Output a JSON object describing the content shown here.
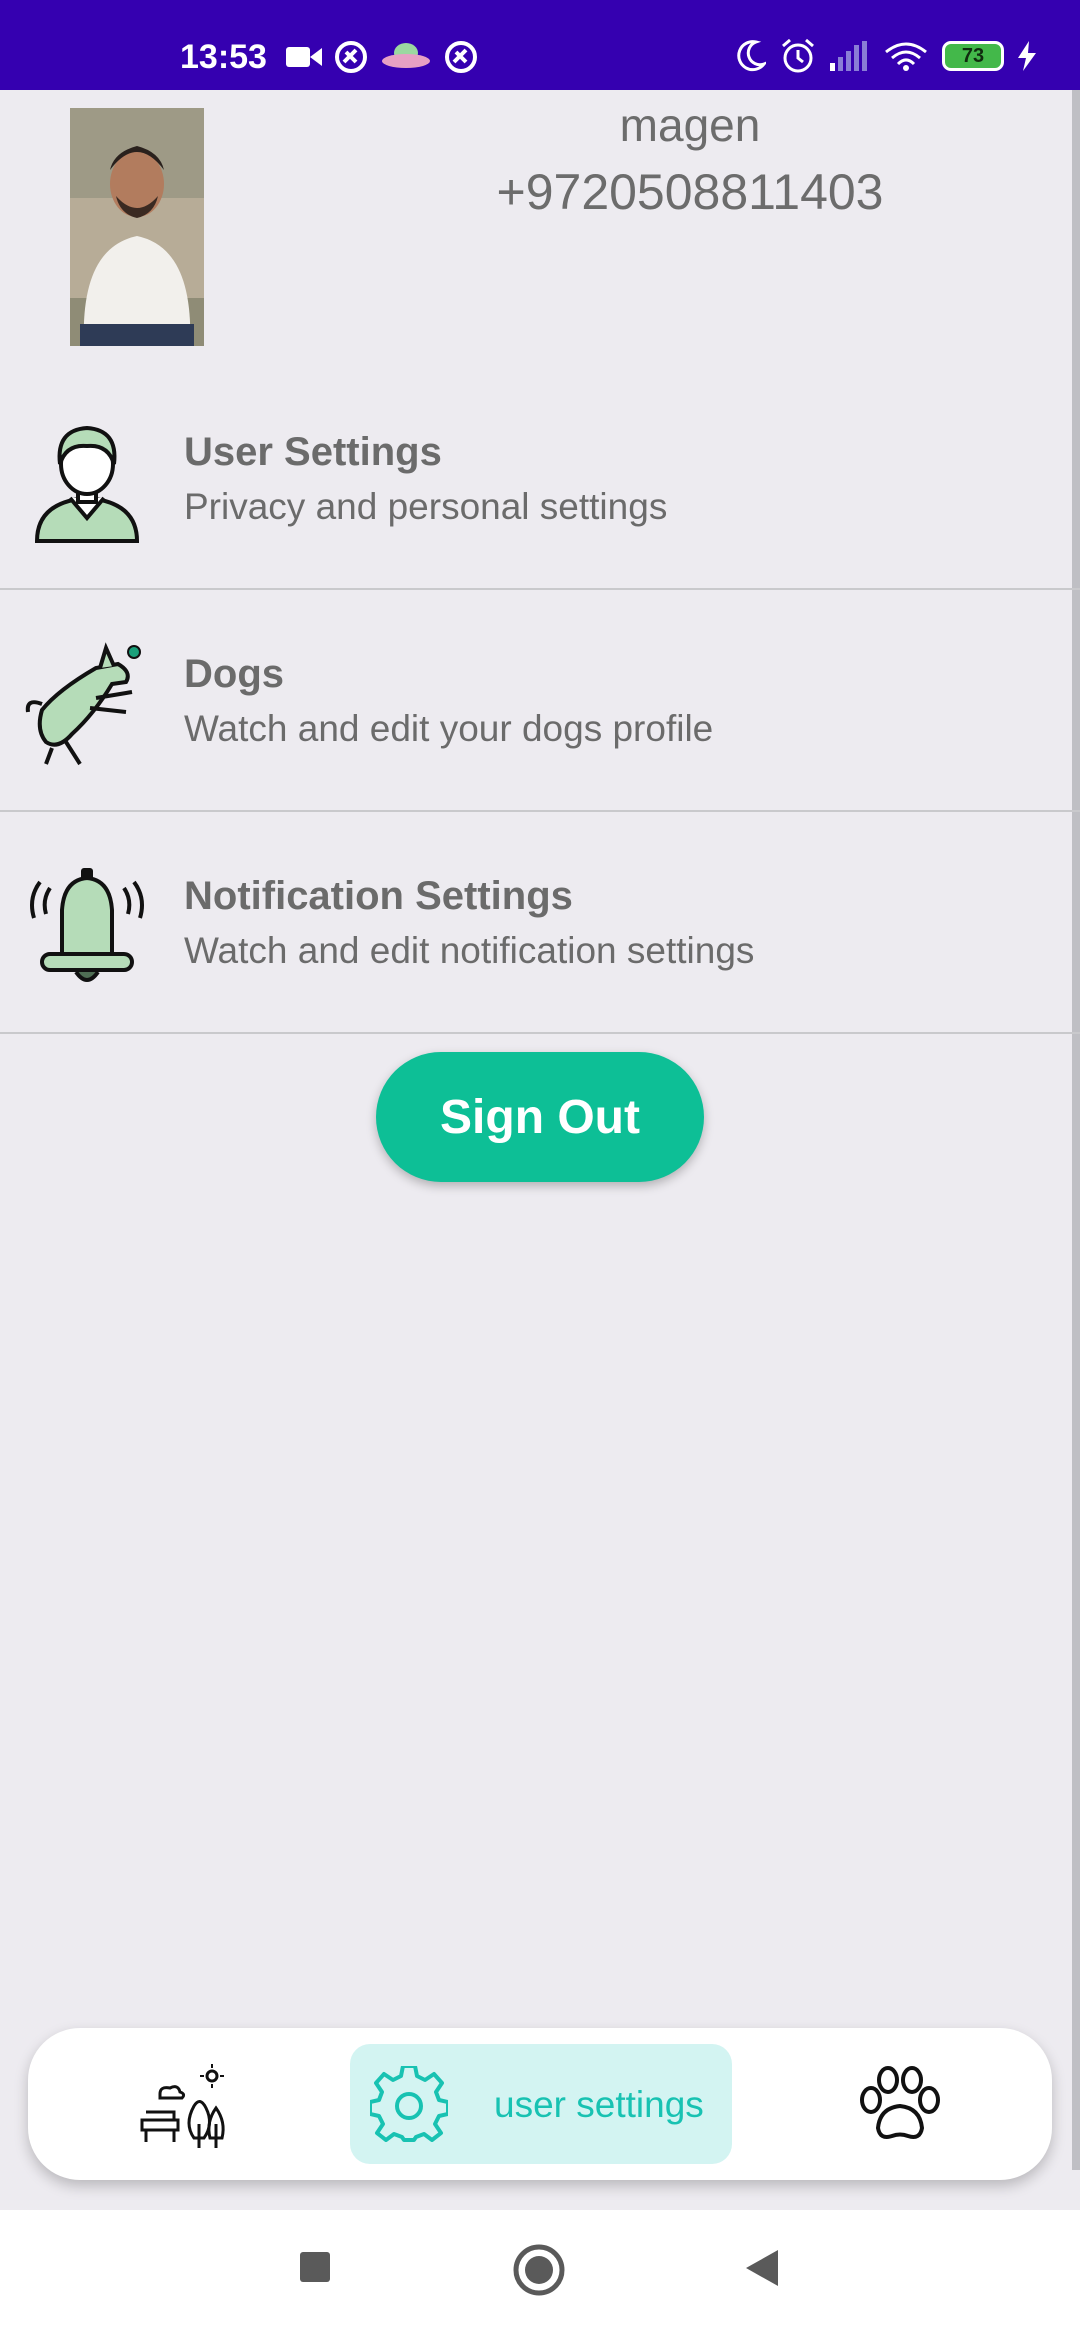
{
  "statusbar": {
    "time": "13:53",
    "battery": "73",
    "left_icons": [
      "video-call-icon",
      "app-notification-icon",
      "ufo-icon",
      "app-notification-icon"
    ],
    "right_icons": [
      "do-not-disturb-icon",
      "alarm-icon",
      "cell-signal-icon",
      "wifi-icon",
      "battery-icon",
      "charging-icon"
    ]
  },
  "profile": {
    "name": "magen",
    "phone": "+9720508811403"
  },
  "menu": [
    {
      "title": "User Settings",
      "subtitle": "Privacy and personal settings",
      "icon": "user-avatar-icon"
    },
    {
      "title": "Dogs",
      "subtitle": "Watch and edit your dogs profile",
      "icon": "jumping-dog-icon"
    },
    {
      "title": "Notification Settings",
      "subtitle": "Watch and edit notification settings",
      "icon": "bell-icon"
    }
  ],
  "signout_label": "Sign Out",
  "bottom_nav": {
    "items": [
      {
        "icon": "park-icon"
      },
      {
        "icon": "gear-icon",
        "label": "user settings",
        "active": true
      },
      {
        "icon": "paw-icon"
      }
    ]
  },
  "colors": {
    "status_bar": "#3500b0",
    "accent": "#0dbf96",
    "nav_active_bg": "#d3f4f2",
    "nav_active_text": "#18c2b2",
    "icon_green": "#b5dcb8"
  },
  "system_nav": [
    "recents-icon",
    "home-icon",
    "back-icon"
  ]
}
